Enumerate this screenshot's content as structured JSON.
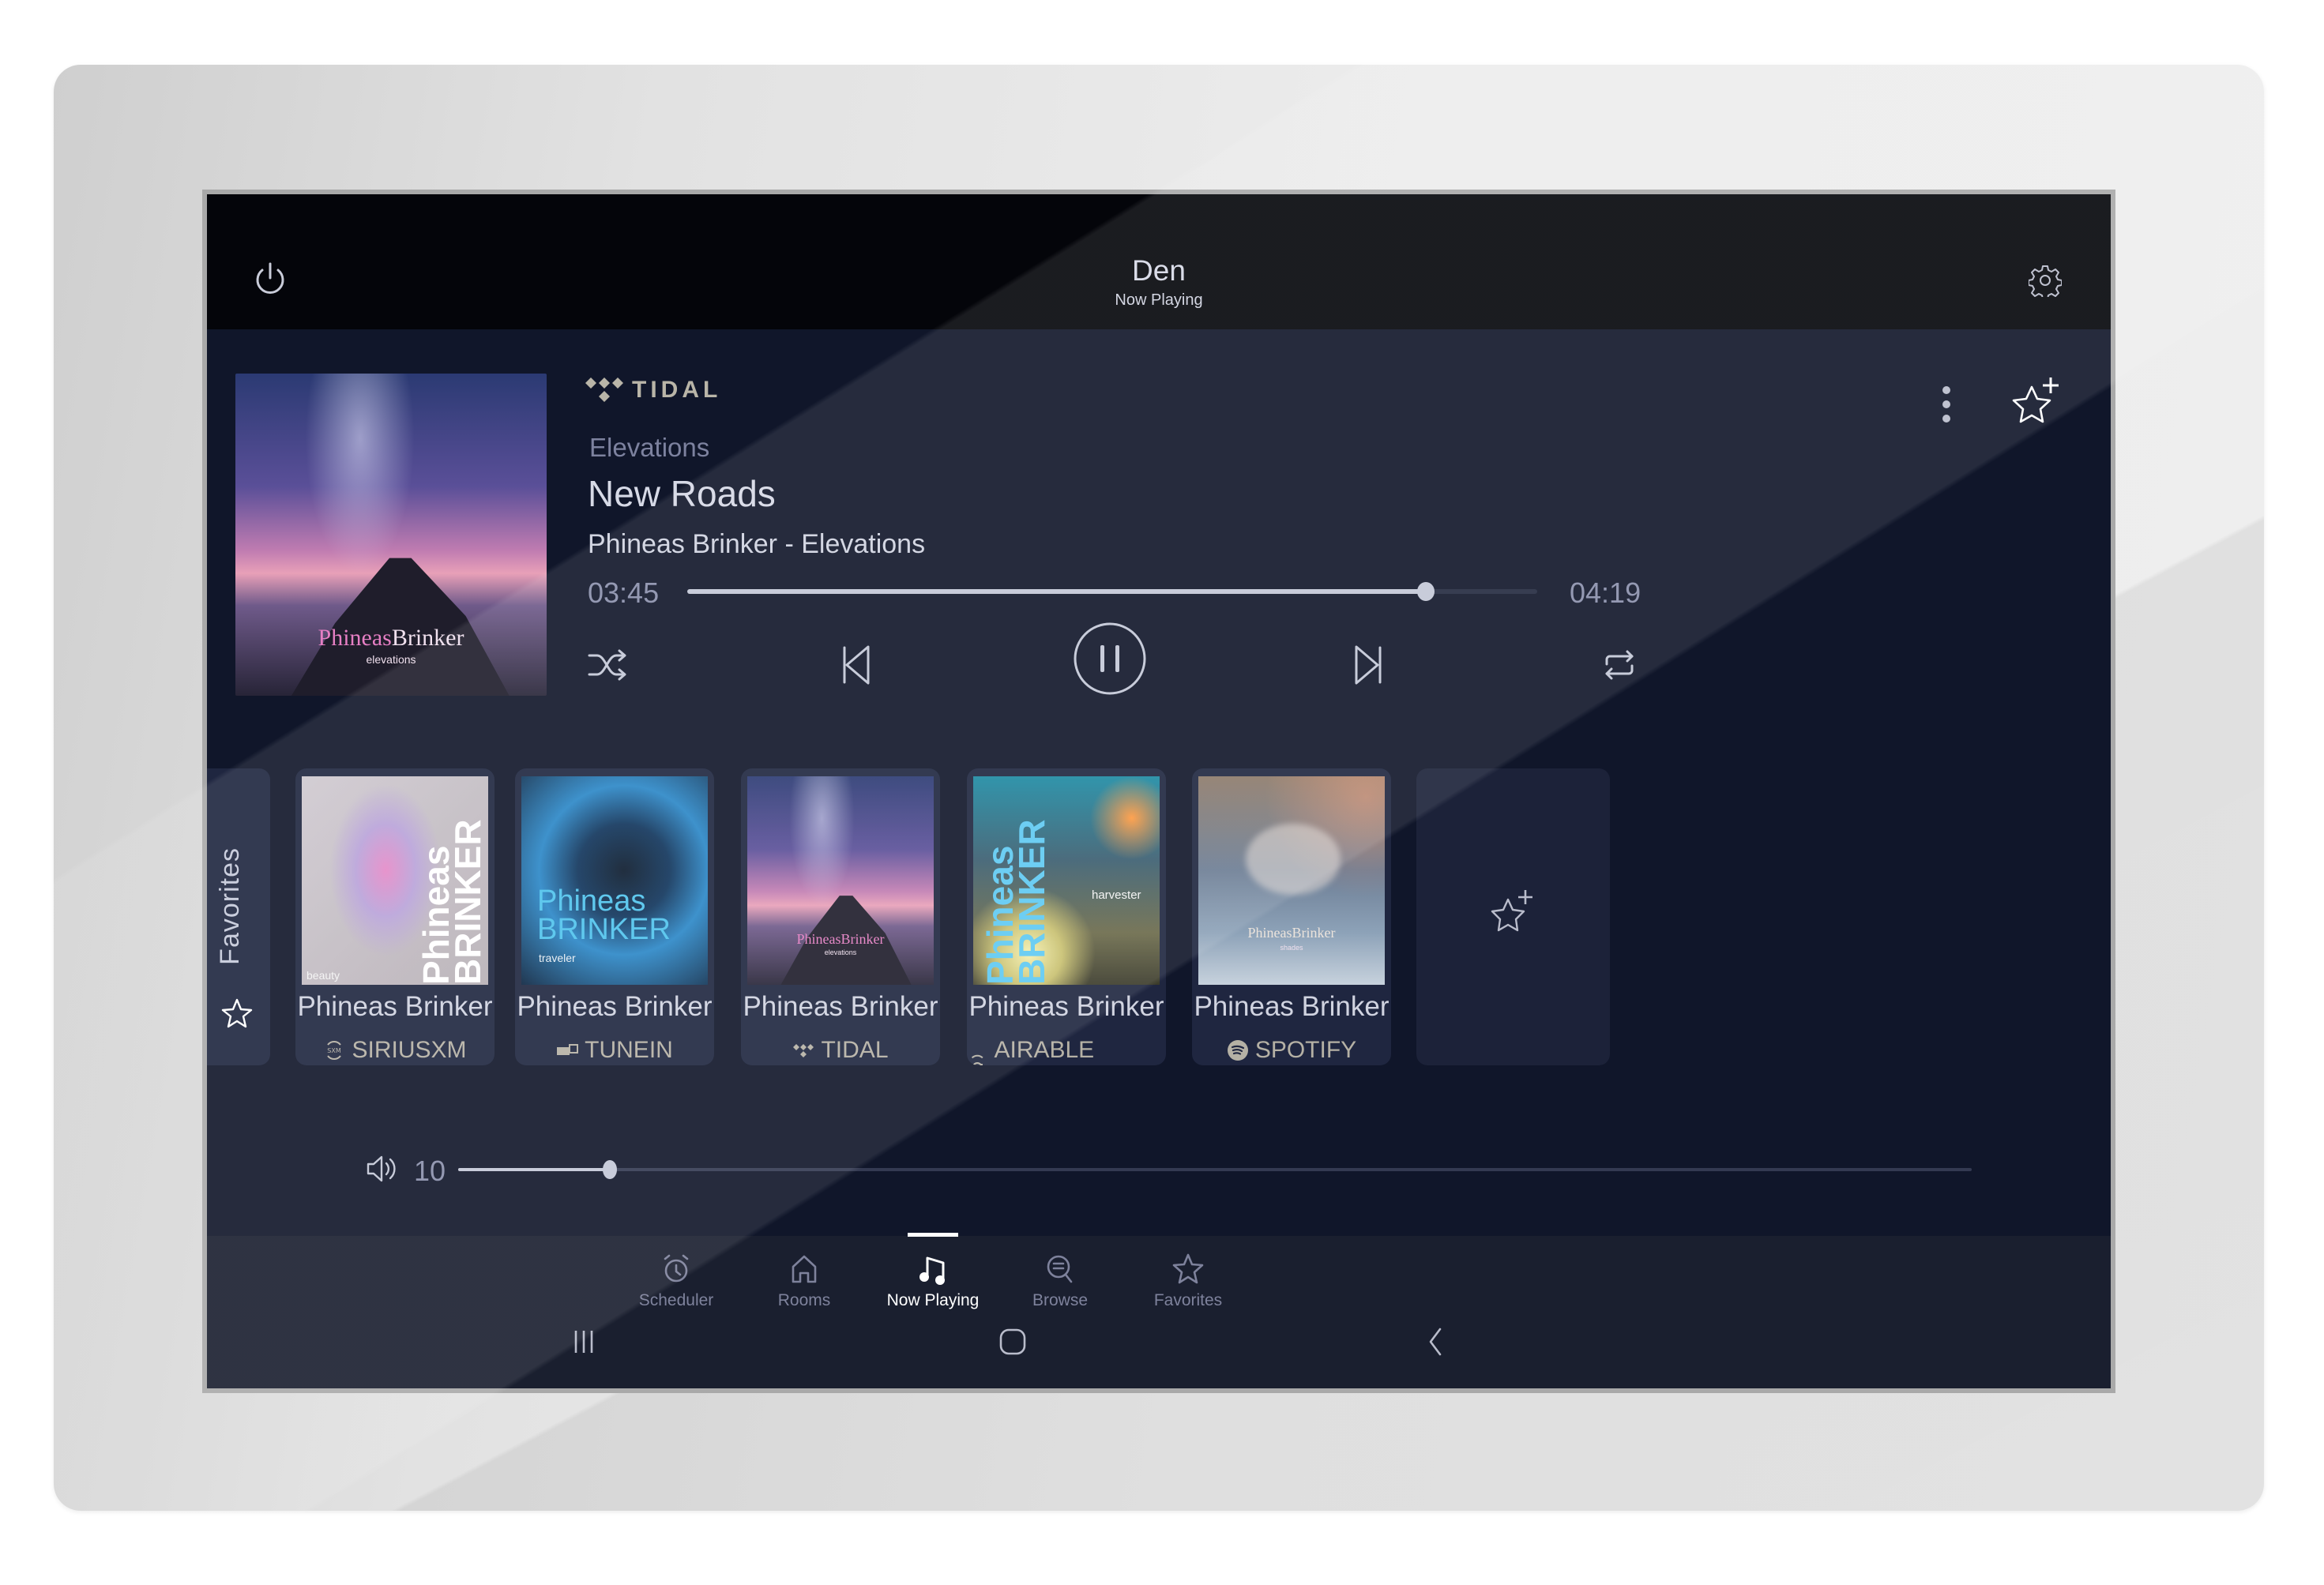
{
  "header": {
    "room": "Den",
    "subtitle": "Now Playing"
  },
  "now_playing": {
    "source": "TIDAL",
    "album": "Elevations",
    "title": "New Roads",
    "artist_album": "Phineas Brinker - Elevations",
    "elapsed": "03:45",
    "duration": "04:19",
    "progress_fraction": 0.869,
    "art": {
      "artist_plain": "Brinker",
      "artist_pink": "Phineas",
      "album_caption": "elevations"
    },
    "controls": {
      "shuffle": "shuffle-icon",
      "previous": "skip-previous-icon",
      "play_state": "pause-icon",
      "next": "skip-next-icon",
      "repeat": "repeat-icon"
    }
  },
  "favorites": {
    "tab_label": "Favorites",
    "items": [
      {
        "name": "Phineas Brinker",
        "service": "SIRIUSXM",
        "service_icon": "siriusxm-icon",
        "cover_text": "Phineas BRINKER",
        "cover_sub": "beauty"
      },
      {
        "name": "Phineas Brinker",
        "service": "TUNEIN",
        "service_icon": "tunein-icon",
        "cover_text": "Phineas BRINKER",
        "cover_sub": "traveler"
      },
      {
        "name": "Phineas Brinker",
        "service": "TIDAL",
        "service_icon": "tidal-icon",
        "cover_text": "PhineasBrinker",
        "cover_sub": "elevations"
      },
      {
        "name": "Phineas Brinker",
        "service": "AIRABLE RADIO",
        "service_icon": "airable-icon",
        "cover_text": "Phineas BRINKER",
        "cover_sub": "harvester"
      },
      {
        "name": "Phineas Brinker",
        "service": "SPOTIFY",
        "service_icon": "spotify-icon",
        "cover_text": "PhineasBrinker",
        "cover_sub": "shades"
      }
    ],
    "add_label": "add-favorite"
  },
  "volume": {
    "value": "10",
    "fraction": 0.1
  },
  "nav": {
    "items": [
      {
        "label": "Scheduler",
        "icon": "alarm-clock-icon",
        "active": false
      },
      {
        "label": "Rooms",
        "icon": "home-icon",
        "active": false
      },
      {
        "label": "Now Playing",
        "icon": "music-note-icon",
        "active": true
      },
      {
        "label": "Browse",
        "icon": "browse-search-icon",
        "active": false
      },
      {
        "label": "Favorites",
        "icon": "star-icon",
        "active": false
      }
    ]
  },
  "system_nav": {
    "recents": "recents-icon",
    "home": "home-button-icon",
    "back": "back-icon"
  },
  "colors": {
    "screen_bg": "#10162a",
    "header_bg": "#04050a",
    "card_bg": "#1f2640",
    "nav_bg": "#1a1f2f",
    "text_primary": "#d6d9e6",
    "text_muted": "#7e829c",
    "source_accent": "#b9b5a8",
    "slider": "#c3c7d6"
  }
}
